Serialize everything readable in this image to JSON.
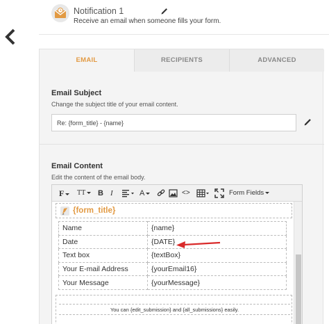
{
  "header": {
    "title": "Notification 1",
    "subtitle": "Receive an email when someone fills your form."
  },
  "tabs": [
    {
      "label": "EMAIL",
      "active": true
    },
    {
      "label": "RECIPIENTS",
      "active": false
    },
    {
      "label": "ADVANCED",
      "active": false
    }
  ],
  "subject": {
    "label": "Email Subject",
    "description": "Change the subject title of your email content.",
    "value": "Re: {form_title} - {name}"
  },
  "content": {
    "label": "Email Content",
    "description": "Edit the content of the email body."
  },
  "toolbar": {
    "font_label": "F",
    "size_label": "TT",
    "bold_label": "B",
    "italic_label": "I",
    "color_label": "A",
    "code_label": "<>",
    "fields_label": "Form Fields"
  },
  "editor": {
    "form_title_token": "{form_title}",
    "rows": [
      {
        "label": "Name",
        "value": "{name}"
      },
      {
        "label": "Date",
        "value": "{DATE}"
      },
      {
        "label": "Text box",
        "value": "{textBox}"
      },
      {
        "label": "Your E-mail Address",
        "value": "{yourEmail16}"
      },
      {
        "label": "Your Message",
        "value": "{yourMessage}"
      }
    ],
    "footer_text": "You can {edit_submission} and {all_submissions} easily."
  },
  "colors": {
    "accent": "#e29a43",
    "arrow": "#d92a2a"
  }
}
